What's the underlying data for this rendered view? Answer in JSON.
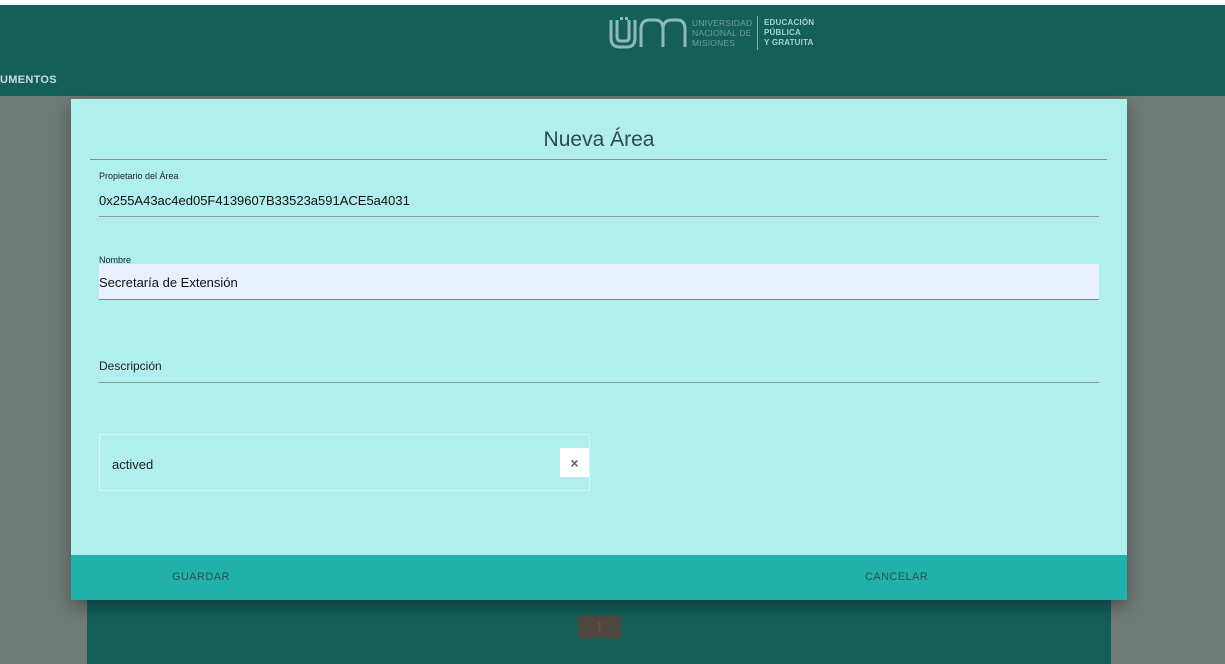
{
  "header": {
    "logo": {
      "mark": "ÜNM",
      "university_lines": [
        "UNIVERSIDAD",
        "NACIONAL DE",
        "MISIONES"
      ],
      "slogan_lines": [
        "EDUCACIÓN",
        "PÚBLICA",
        "Y GRATUITA"
      ]
    },
    "nav_item": "UMENTOS"
  },
  "pagination": {
    "current_page": "1"
  },
  "modal": {
    "title": "Nueva Área",
    "owner": {
      "label": "Propietario del Área",
      "value": "0x255A43ac4ed05F4139607B33523a591ACE5a4031"
    },
    "name": {
      "label": "Nombre",
      "value": "Secretaría de Extensión"
    },
    "description": {
      "label": "Descripción"
    },
    "status": {
      "value": "actived",
      "clear_icon": "close-icon",
      "clear_glyph": "×"
    },
    "footer": {
      "save_label": "GUARDAR",
      "cancel_label": "CANCELAR"
    }
  },
  "colors": {
    "header_bg": "#155f5a",
    "modal_bg": "#b1eeee",
    "footer_bg": "#20b2aa",
    "input_bg": "#e8f0fe"
  }
}
